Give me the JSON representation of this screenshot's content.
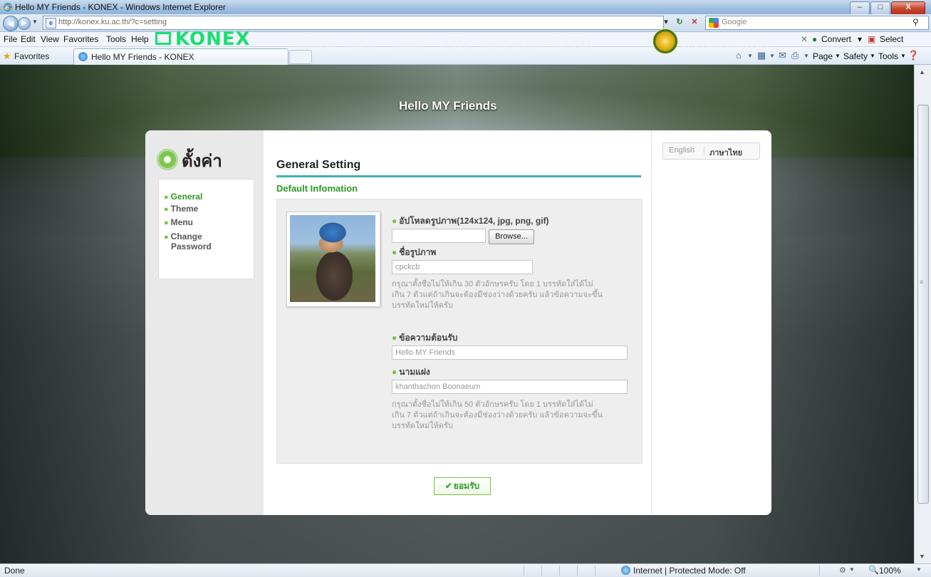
{
  "window": {
    "title": "Hello MY Friends - KONEX - Windows Internet Explorer",
    "minimize": "–",
    "maximize": "□",
    "close": "X"
  },
  "address_bar": {
    "url": "http://konex.ku.ac.th/?c=setting",
    "search_placeholder": "Google"
  },
  "menu_bar": {
    "items": [
      "File",
      "Edit",
      "View",
      "Favorites",
      "Tools",
      "Help"
    ],
    "right": [
      "Convert",
      "Select"
    ]
  },
  "favorites_bar": {
    "favorites_label": "Favorites",
    "tab_title": "Hello MY Friends - KONEX",
    "commands": [
      "Page",
      "Safety",
      "Tools"
    ]
  },
  "site": {
    "logo": "KONEX",
    "nav": [
      "หน้าแรก",
      "เพื่อน",
      "รูปภาพ",
      "วิดีโอ",
      "กระดานข่าว",
      "โปรไฟล์"
    ],
    "university_th": "มหาวิทยาลัยเกษตรศาสตร์",
    "university_en": "Kasetsart University",
    "banner_title": "Hello MY Friends"
  },
  "settings": {
    "heading": "ตั้งค่า",
    "menu": [
      "General",
      "Theme",
      "Menu",
      "Change",
      "Password"
    ],
    "language": {
      "english": "English",
      "thai": "ภาษาไทย"
    },
    "content_title": "General Setting",
    "section_title": "Default Infomation",
    "upload_label": "อัปโหลดรูปภาพ(124x124, jpg, png, gif)",
    "browse_label": "Browse...",
    "picture_name_label": "ชื่อรูปภาพ",
    "picture_name_value": "cpckcb",
    "picture_help": [
      "กรุณาตั้งชื่อไม่ให้เกิน 30 ตัวอักษรครับ โดย 1 บรรทัดใส่ได้ไม่",
      "เกิน 7 ตัวแต่ถ้าเกินจะต้องมีช่องว่างด้วยครับ แล้วข้อความจะขึ้น",
      "บรรทัดใหม่ให้ครับ"
    ],
    "welcome_label": "ข้อความต้อนรับ",
    "welcome_value": "Hello MY Friends",
    "nickname_label": "นามแฝง",
    "nickname_value": "khanthachon Boonaeum",
    "nickname_help": [
      "กรุณาตั้งชื่อไม่ให้เกิน 50 ตัวอักษรครับ โดย 1 บรรทัดใส่ได้ไม่",
      "เกิน 7 ตัวแต่ถ้าเกินจะต้องมีช่องว่างด้วยครับ แล้วข้อความจะขึ้น",
      "บรรทัดใหม่ให้ครับ"
    ],
    "submit_label": "ยอมรับ"
  },
  "status_bar": {
    "left": "Done",
    "zone": "Internet | Protected Mode: Off",
    "zoom": "100%"
  }
}
